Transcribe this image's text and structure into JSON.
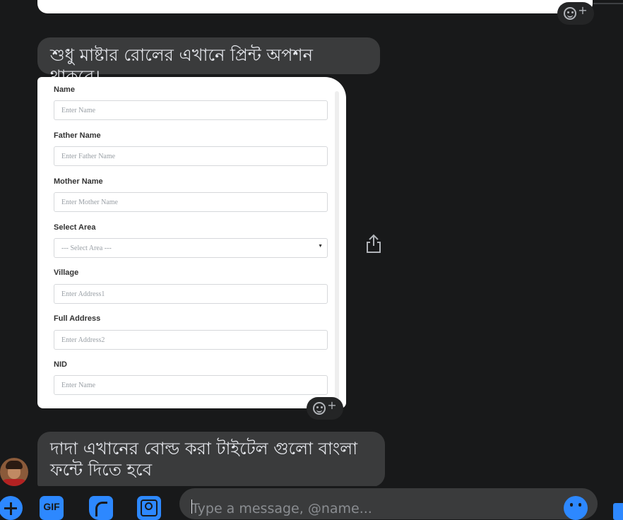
{
  "messages": [
    {
      "text": "শুধু মাষ্টার রোলের এখানে প্রিন্ট অপশন থাকবে।"
    },
    {
      "text": "দাদা এখানের বোল্ড করা টাইটেল গুলো বাংলা ফন্টে দিতে হবে"
    }
  ],
  "attached_form": {
    "fields": [
      {
        "label": "Name",
        "placeholder": "Enter Name"
      },
      {
        "label": "Father Name",
        "placeholder": "Enter Father Name"
      },
      {
        "label": "Mother Name",
        "placeholder": "Enter Mother Name"
      },
      {
        "label": "Select Area",
        "placeholder": "--- Select Area ---"
      },
      {
        "label": "Village",
        "placeholder": "Enter Address1"
      },
      {
        "label": "Full Address",
        "placeholder": "Enter Address2"
      },
      {
        "label": "NID",
        "placeholder": "Enter Name"
      }
    ]
  },
  "composer": {
    "gif_label": "GIF",
    "placeholder": "Type a message, @name..."
  },
  "colors": {
    "accent": "#2d88ff",
    "bubble": "#3a3b3c",
    "background": "#18191a"
  },
  "icons": [
    "reaction-add-icon",
    "share-icon",
    "plus-icon",
    "gif-icon",
    "sticker-icon",
    "image-icon",
    "emoji-icon",
    "like-icon"
  ]
}
